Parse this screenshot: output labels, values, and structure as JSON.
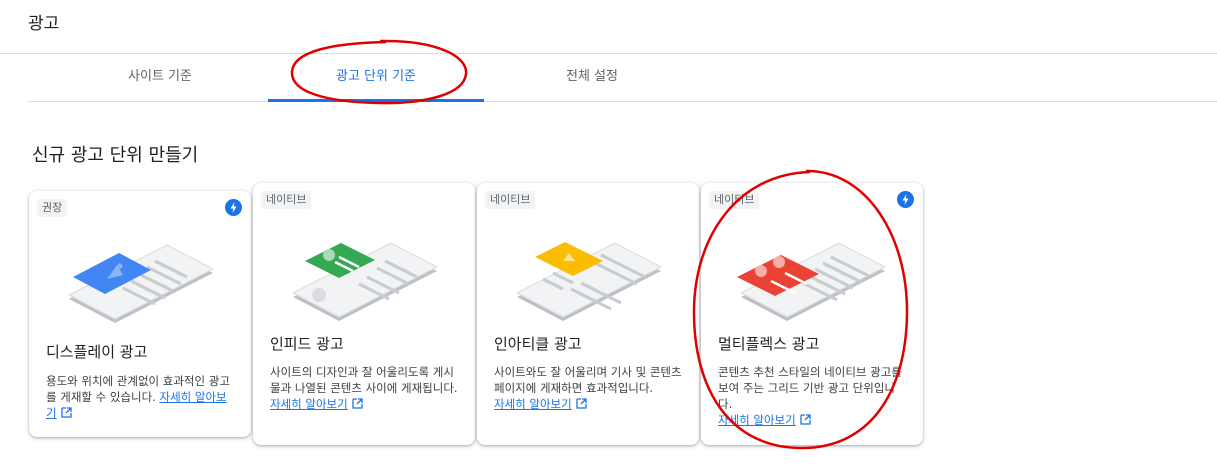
{
  "page": {
    "title": "광고"
  },
  "tabs": [
    {
      "label": "사이트 기준"
    },
    {
      "label": "광고 단위 기준"
    },
    {
      "label": "전체 설정"
    }
  ],
  "section": {
    "title": "신규 광고 단위 만들기"
  },
  "cards": [
    {
      "badge": "권장",
      "title": "디스플레이 광고",
      "description": "용도와 위치에 관계없이 효과적인 광고를 게재할 수 있습니다.",
      "link": "자세히 알아보기",
      "accent": "#4285f4",
      "icon": "image-icon"
    },
    {
      "badge": "네이티브",
      "title": "인피드 광고",
      "description": "사이트의 디자인과 잘 어울리도록 게시물과 나열된 콘텐츠 사이에 게재됩니다.",
      "link": "자세히 알아보기",
      "accent": "#34a853",
      "icon": "list-icon"
    },
    {
      "badge": "네이티브",
      "title": "인아티클 광고",
      "description": "사이트와도 잘 어울리며 기사 및 콘텐츠 페이지에 게재하면 효과적입니다.",
      "link": "자세히 알아보기",
      "accent": "#fbbc04",
      "icon": "article-icon"
    },
    {
      "badge": "네이티브",
      "title": "멀티플렉스 광고",
      "description": "콘텐츠 추천 스타일의 네이티브 광고를 보여 주는 그리드 기반 광고 단위입니다.",
      "link": "자세히 알아보기",
      "accent": "#ea4335",
      "icon": "grid-icon"
    }
  ],
  "colors": {
    "primary": "#1a73e8",
    "annotation": "#e00000"
  }
}
